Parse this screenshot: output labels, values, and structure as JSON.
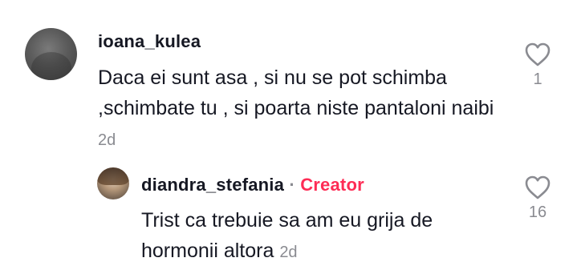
{
  "comments": [
    {
      "username": "ioana_kulea",
      "text": "Daca ei sunt asa , si nu se pot schimba ,schimbate tu , si poarta niste pantaloni naibi",
      "date": "2d",
      "likes": "1",
      "avatar_icon": "user-avatar"
    }
  ],
  "reply": {
    "username": "diandra_stefania",
    "separator": "·",
    "badge": "Creator",
    "text": "Trist ca trebuie sa am eu grija de hormonii altora",
    "date": "2d",
    "likes": "16",
    "avatar_icon": "user-avatar"
  },
  "colors": {
    "creator": "#fe2c55",
    "muted": "#8a8b91",
    "text": "#161823"
  },
  "icons": {
    "like": "heart-outline-icon"
  }
}
